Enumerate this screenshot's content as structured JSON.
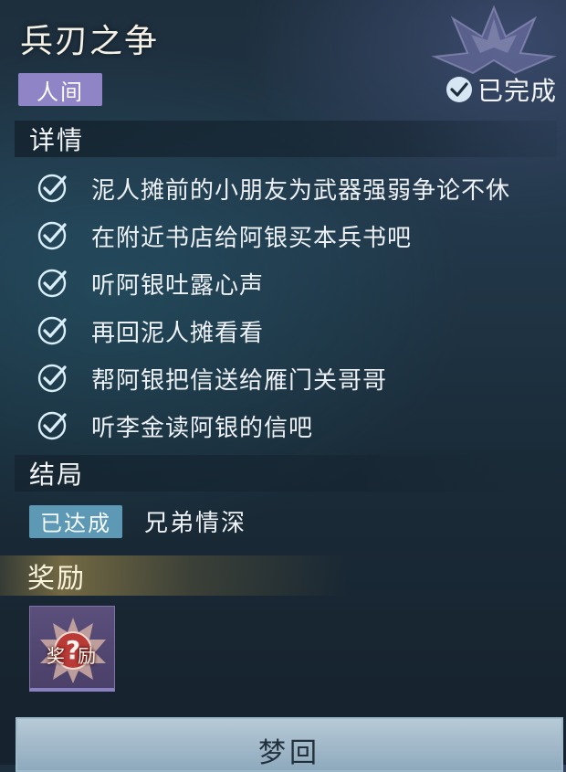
{
  "quest": {
    "title": "兵刃之争",
    "realm": "人间",
    "status": "已完成",
    "status_icon": "check-circle-icon"
  },
  "details": {
    "header": "详情",
    "tasks": [
      {
        "text": "泥人摊前的小朋友为武器强弱争论不休",
        "done": true
      },
      {
        "text": "在附近书店给阿银买本兵书吧",
        "done": true
      },
      {
        "text": "听阿银吐露心声",
        "done": true
      },
      {
        "text": "再回泥人摊看看",
        "done": true
      },
      {
        "text": "帮阿银把信送给雁门关哥哥",
        "done": true
      },
      {
        "text": "听李金读阿银的信吧",
        "done": true
      }
    ]
  },
  "ending": {
    "header": "结局",
    "badge": "已达成",
    "name": "兄弟情深"
  },
  "reward": {
    "header": "奖励",
    "item_label": "奖励",
    "item_icon": "question-mark-emblem-icon"
  },
  "button": {
    "label": "梦回"
  },
  "colors": {
    "realm_tag": "#8f85c6",
    "achieved_badge": "#5d98b5",
    "check": "#d9eef8",
    "button": "#a7bccb"
  }
}
